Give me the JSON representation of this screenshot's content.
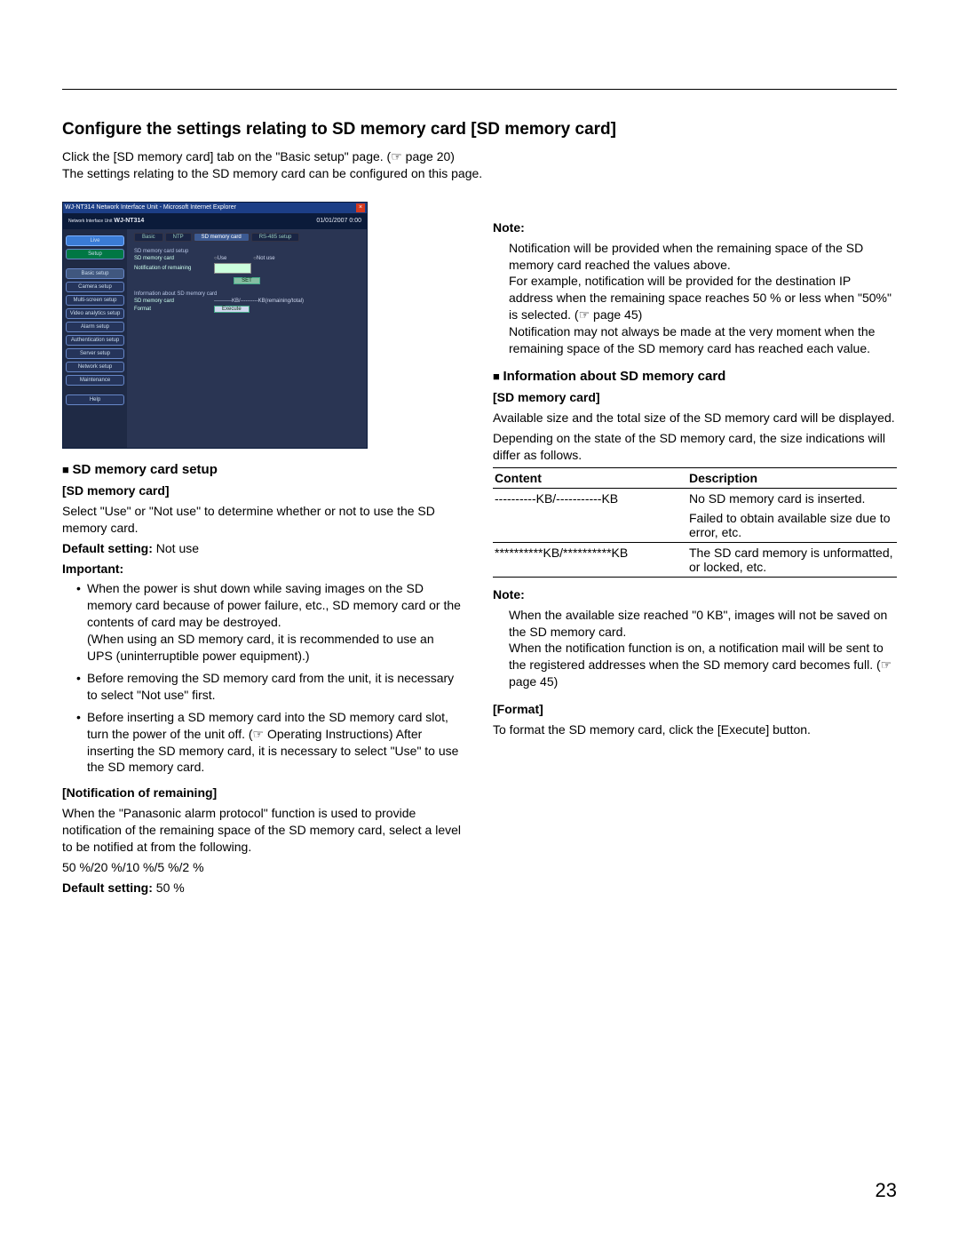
{
  "page": {
    "number": "23",
    "title": "Configure the settings relating to SD memory card [SD memory card]",
    "intro_line1": "Click the [SD memory card] tab on the \"Basic setup\" page. (☞ page 20)",
    "intro_line2": "The settings relating to the SD memory card can be configured on this page."
  },
  "screenshot": {
    "browser_title": "WJ-NT314 Network Interface Unit - Microsoft Internet Explorer",
    "model_small": "Network Interface Unit",
    "model": "WJ-NT314",
    "datetime": "01/01/2007  0:00",
    "tabs": [
      "Live",
      "Setup"
    ],
    "sidebar": [
      "Basic setup",
      "Camera setup",
      "Multi-screen setup",
      "Video analytics setup",
      "Alarm setup",
      "Authentication setup",
      "Server setup",
      "Network setup",
      "Maintenance",
      "Help"
    ],
    "inner_tabs": [
      "Basic",
      "NTP",
      "SD memory card",
      "RS-485 setup"
    ],
    "group1": "SD memory card setup",
    "row_sdcard": "SD memory card",
    "opt_use": "Use",
    "opt_notuse": "Not use",
    "row_notif": "Notification of remaining",
    "btn_set": "SET",
    "group2": "Information about SD memory card",
    "row_sdcard2": "SD memory card",
    "kb_line": "----------KB/----------KB(remaining/total)",
    "row_format": "Format",
    "btn_exec": "Execute"
  },
  "left": {
    "section1": "SD memory card setup",
    "s1_label": "[SD memory card]",
    "s1_body": "Select \"Use\" or \"Not use\" to determine whether or not to use the SD memory card.",
    "s1_default_label": "Default setting:",
    "s1_default_value": " Not use",
    "important_label": "Important:",
    "important_items": {
      "i1a": "When the power is shut down while saving images on the SD memory card because of power failure, etc., SD memory card or the contents of card may be destroyed.",
      "i1b": "(When using an SD memory card, it is recommended to use an UPS (uninterruptible power equipment).)",
      "i2": "Before removing the SD memory card from the unit, it is necessary to select \"Not use\" first.",
      "i3": "Before inserting a SD memory card into the SD memory card slot, turn the power of the unit off. (☞ Operating Instructions) After inserting the SD memory card, it is necessary to select \"Use\" to use the SD memory card."
    },
    "notif_label": "[Notification of remaining]",
    "notif_body": "When the \"Panasonic alarm protocol\" function is used to provide notification of the remaining space of the SD memory card, select a level to be notified at from the following.",
    "notif_levels": "50 %/20 %/10 %/5 %/2 %",
    "notif_default_label": "Default setting:",
    "notif_default_value": " 50 %"
  },
  "right": {
    "note1_label": "Note:",
    "note1_p1": "Notification will be provided when the remaining space of the SD memory card reached the values above.",
    "note1_p2": "For example, notification will be provided for the destination IP address when the remaining space reaches 50 % or less when \"50%\" is selected. (☞ page 45)",
    "note1_p3": "Notification may not always be made at the very moment when the remaining space of the SD memory card has reached each value.",
    "section2": "Information about SD memory card",
    "s2_label": "[SD memory card]",
    "s2_body1": "Available size and the total size of the SD memory card will be displayed.",
    "s2_body2": "Depending on the state of the SD memory card, the size indications will differ as follows.",
    "table": {
      "h1": "Content",
      "h2": "Description",
      "r1c1": "----------KB/-----------KB",
      "r1c2a": "No SD memory card is inserted.",
      "r1c2b": "Failed to obtain available size due to error, etc.",
      "r2c1": "**********KB/**********KB",
      "r2c2": "The SD card memory is unformatted, or locked, etc."
    },
    "note2_label": "Note:",
    "note2_p1": "When the available size reached \"0 KB\", images will not be saved on the SD memory card.",
    "note2_p2": "When the notification function is on, a notification mail will be sent to the registered addresses when the SD memory card becomes full. (☞ page 45)",
    "format_label": "[Format]",
    "format_body": "To format the SD memory card, click the [Execute] button."
  }
}
